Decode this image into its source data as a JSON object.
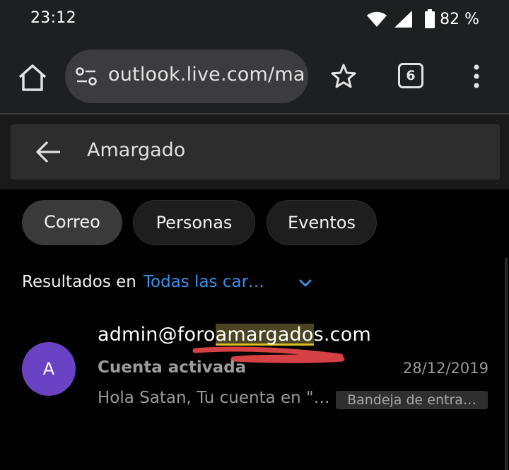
{
  "status_bar": {
    "time": "23:12",
    "battery": "82 %",
    "icons": [
      "wifi-icon",
      "signal-icon",
      "battery-icon"
    ]
  },
  "browser": {
    "url": "outlook.live.com/ma",
    "tab_count": "6",
    "icons": [
      "home-icon",
      "site-settings-icon",
      "star-icon",
      "tabs-icon",
      "more-vertical-icon"
    ]
  },
  "search": {
    "query": "Amargado",
    "back_icon": "arrow-left-icon"
  },
  "filters": {
    "chips": [
      {
        "label": "Correo",
        "selected": true
      },
      {
        "label": "Personas",
        "selected": false
      },
      {
        "label": "Eventos",
        "selected": false
      }
    ]
  },
  "results": {
    "label": "Resultados en",
    "folder": "Todas las car…",
    "accent_color": "#3a91e8"
  },
  "mail": {
    "avatar_letter": "A",
    "avatar_color": "#6a43c4",
    "sender_prefix": "admin@foro",
    "sender_match": "amargado",
    "sender_suffix": "s.com",
    "subject": "Cuenta activada",
    "date": "28/12/2019",
    "preview": "Hola Satan, Tu cuenta en \"…",
    "folder_badge": "Bandeja de entra…",
    "annotation_color": "#e8474c"
  }
}
